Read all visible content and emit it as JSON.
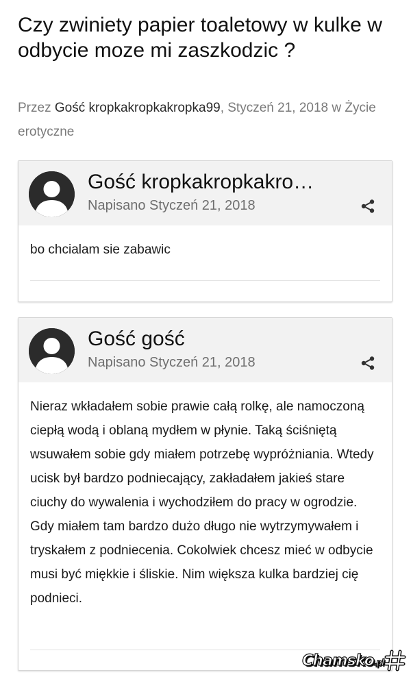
{
  "topic": {
    "title": "Czy zwiniety papier toaletowy w kulke w odbycie moze mi zaszkodzic ?",
    "by_prefix": "Przez",
    "author": "Gość kropkakropkakropka99",
    "date_suffix": ", Styczeń 21, 2018 w Życie erotyczne"
  },
  "posts": [
    {
      "author": "Gość kropkakropkakro…",
      "date": "Napisano Styczeń 21, 2018",
      "body": "bo chcialam sie zabawic"
    },
    {
      "author": "Gość gość",
      "date": "Napisano Styczeń 21, 2018",
      "body": "Nieraz wkładałem sobie prawie całą rolkę, ale namoczoną ciepłą wodą i oblaną mydłem w płynie. Taką ściśniętą wsuwałem sobie gdy miałem potrzebę wypróżniania. Wtedy ucisk był bardzo podniecający, zakładałem jakieś stare ciuchy do wywalenia i wychodziłem do pracy w ogrodzie. Gdy miałem tam bardzo dużo długo nie wytrzymywałem i tryskałem z podniecenia. Cokolwiek chcesz mieć w odbycie musi być miękkie i śliskie. Nim większa kulka bardziej cię podnieci."
    }
  ],
  "icons": {
    "avatar": "user-silhouette-icon",
    "share": "share-icon",
    "watermark_mark": "hash-logo-icon"
  },
  "watermark": {
    "text": "Chamsko",
    "suffix": ".pl"
  },
  "colors": {
    "header_bg": "#f2f2f2",
    "avatar_bg": "#2b2b2b",
    "muted_text": "#7a7a7a"
  }
}
